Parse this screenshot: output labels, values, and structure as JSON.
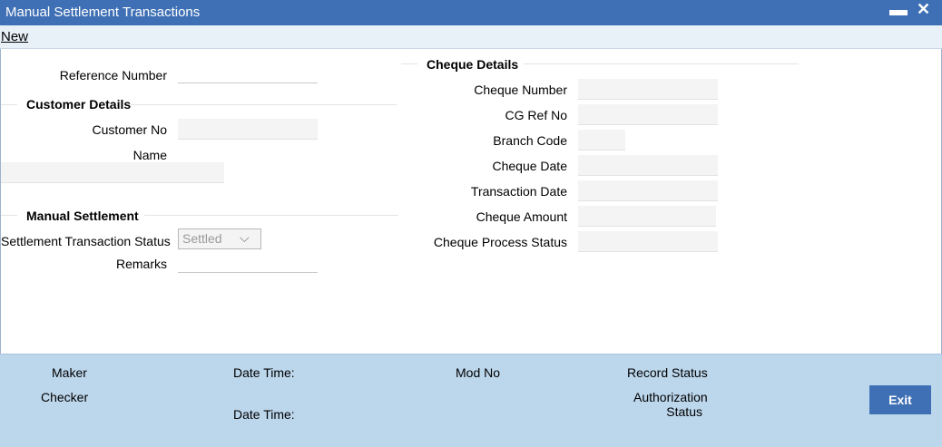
{
  "window": {
    "title": "Manual Settlement Transactions",
    "minimize_glyph": "▬",
    "close_glyph": "✕"
  },
  "toolbar": {
    "new_label": "New"
  },
  "form": {
    "reference_number": {
      "label": "Reference Number",
      "value": ""
    },
    "customer_details": {
      "heading": "Customer Details",
      "customer_no": {
        "label": "Customer No",
        "value": ""
      },
      "name": {
        "label": "Name",
        "value": ""
      }
    },
    "manual_settlement": {
      "heading": "Manual Settlement",
      "status": {
        "label": "Settlement Transaction Status",
        "value": "Settled",
        "options": [
          "Settled"
        ]
      },
      "remarks": {
        "label": "Remarks",
        "value": ""
      }
    },
    "cheque_details": {
      "heading": "Cheque Details",
      "cheque_number": {
        "label": "Cheque Number",
        "value": ""
      },
      "cg_ref_no": {
        "label": "CG Ref No",
        "value": ""
      },
      "branch_code": {
        "label": "Branch Code",
        "value": ""
      },
      "cheque_date": {
        "label": "Cheque Date",
        "value": ""
      },
      "transaction_date": {
        "label": "Transaction Date",
        "value": ""
      },
      "cheque_amount": {
        "label": "Cheque Amount",
        "value": ""
      },
      "cheque_process_status": {
        "label": "Cheque Process Status",
        "value": ""
      }
    }
  },
  "footer": {
    "maker": "Maker",
    "checker": "Checker",
    "date_time_1": "Date Time:",
    "date_time_2": "Date Time:",
    "mod_no": "Mod No",
    "record_status": "Record Status",
    "authorization_status_line1": "Authorization",
    "authorization_status_line2": "Status",
    "exit_label": "Exit"
  },
  "colors": {
    "titlebar": "#3f6fb4",
    "footer": "#bcd6ec",
    "button": "#3f6fb4"
  }
}
